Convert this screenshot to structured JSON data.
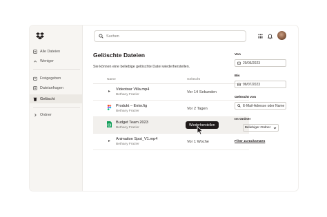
{
  "sidebar": {
    "items": [
      {
        "label": "Alle Dateien",
        "icon": "files-icon"
      },
      {
        "label": "Weniger",
        "icon": "chevron-up-icon"
      },
      {
        "label": "Freigegeben",
        "icon": "share-icon"
      },
      {
        "label": "Dateianfragen",
        "icon": "file-request-icon"
      },
      {
        "label": "Gelöscht",
        "icon": "trash-icon"
      },
      {
        "label": "Ordner",
        "icon": "chevron-right-icon"
      }
    ]
  },
  "search": {
    "placeholder": "Suchen"
  },
  "main": {
    "title": "Gelöschte Dateien",
    "subtitle": "Sie können eine beliebige gelöschte Datei wiederherstellen.",
    "columns": {
      "name": "Name",
      "deleted": "Gelöscht"
    },
    "rows": [
      {
        "name": "Videotour Villa.mp4",
        "user": "Bethany Frazier",
        "deleted": "Vor 14 Sekunden",
        "type": "video"
      },
      {
        "name": "Produkt – Entw.fig",
        "user": "Bethany Frazier",
        "deleted": "Vor 2 Tagen",
        "type": "figma"
      },
      {
        "name": "Budget Team 2023",
        "user": "Bethany Frazier",
        "deleted": "",
        "type": "sheet"
      },
      {
        "name": "Animation Spot_V1.mp4",
        "user": "Bethany Frazier",
        "deleted": "Vor 1 Woche",
        "type": "video"
      }
    ],
    "restore_label": "Wiederherstellen"
  },
  "filters": {
    "from_label": "Von",
    "from_value": "29/06/2023",
    "to_label": "Bis",
    "to_value": "06/07/2023",
    "deleted_by_label": "Gelöscht von",
    "deleted_by_placeholder": "E-Mail-Adresse oder Name",
    "folder_label": "Im Ordner",
    "folder_value": "Beliebiger Ordner",
    "reset_label": "Filter zurücksetzen"
  },
  "colors": {
    "accent": "#1e1919",
    "sidebar_bg": "#f7f5f2",
    "dropbox_blue": "#1e1919"
  }
}
